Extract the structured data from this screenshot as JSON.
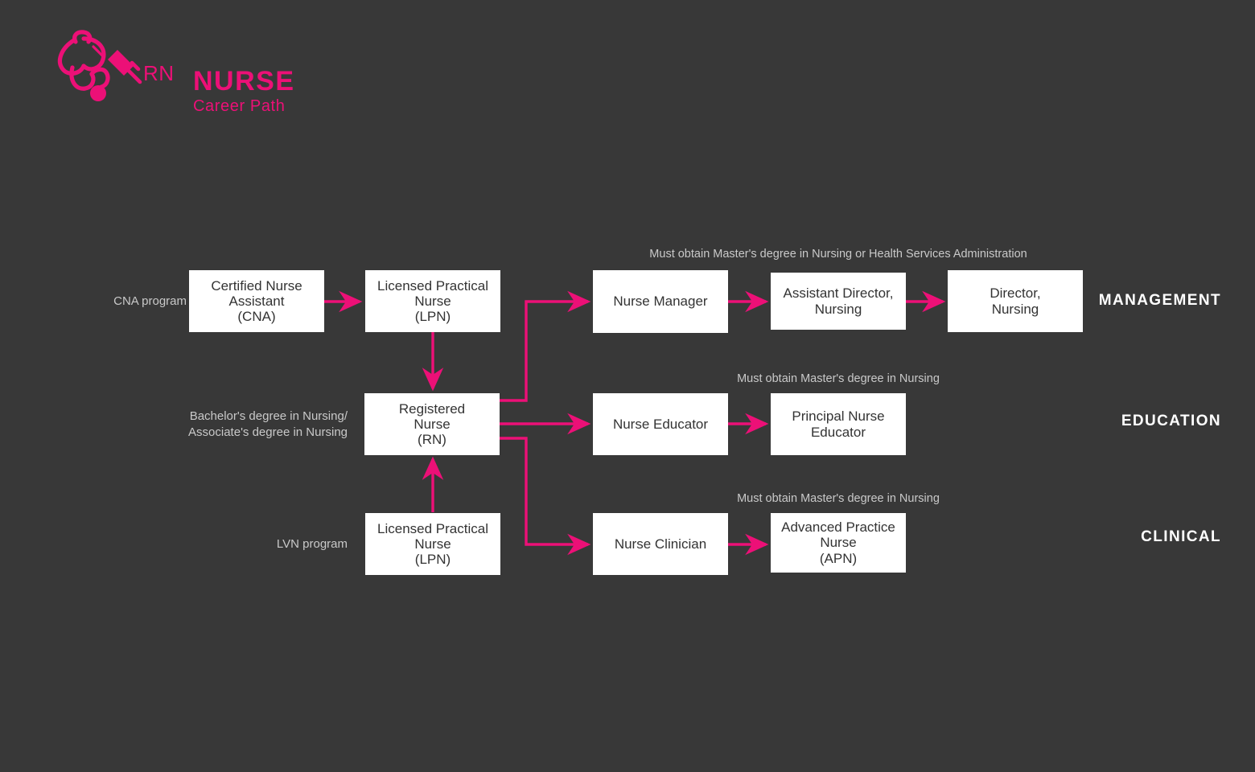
{
  "logo": {
    "badge": "RN",
    "title": "NURSE",
    "subtitle": "Career Path",
    "icon": "stethoscope-syringe-icon",
    "color": "#EC1077"
  },
  "theme": {
    "background": "#383838",
    "accent": "#EC1077",
    "node_fill": "#FFFFFF",
    "node_text": "#333333",
    "label_text": "#C9C9C9",
    "track_text": "#FFFFFF"
  },
  "nodes": {
    "cna": {
      "label": "Certified Nurse\nAssistant\n(CNA)"
    },
    "lpn_top": {
      "label": "Licensed Practical\nNurse\n(LPN)"
    },
    "rn": {
      "label": "Registered\nNurse\n(RN)"
    },
    "lpn_bottom": {
      "label": "Licensed Practical\nNurse\n(LPN)"
    },
    "nurse_manager": {
      "label": "Nurse Manager"
    },
    "asst_director": {
      "label": "Assistant Director,\nNursing"
    },
    "director": {
      "label": "Director,\nNursing"
    },
    "nurse_educator": {
      "label": "Nurse Educator"
    },
    "principal_nurse_educator": {
      "label": "Principal Nurse\nEducator"
    },
    "nurse_clinician": {
      "label": "Nurse Clinician"
    },
    "apn": {
      "label": "Advanced Practice\nNurse\n(APN)"
    }
  },
  "entry_labels": {
    "cna_program": "CNA program",
    "degree_requirement": "Bachelor's degree in Nursing/\nAssociate's degree in Nursing",
    "lvn_program": "LVN program"
  },
  "captions": {
    "management": "Must obtain Master's degree in Nursing or Health Services Administration",
    "education": "Must obtain Master's degree in Nursing",
    "clinical": "Must obtain Master's degree in Nursing"
  },
  "tracks": {
    "management": "MANAGEMENT",
    "education": "EDUCATION",
    "clinical": "CLINICAL"
  }
}
